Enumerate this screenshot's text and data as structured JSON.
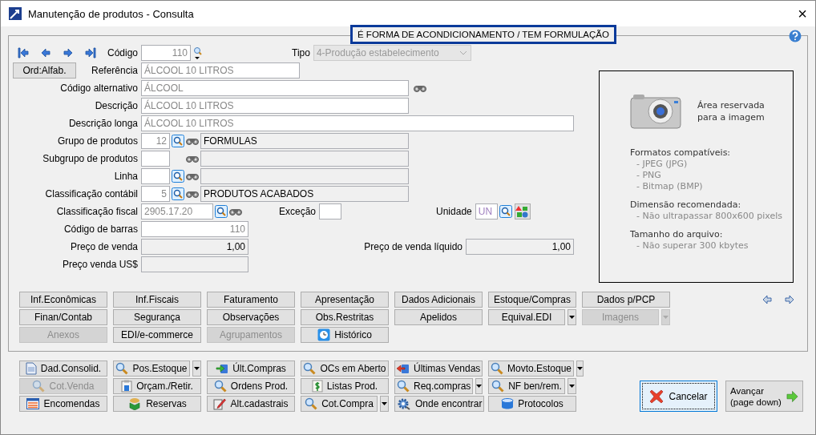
{
  "window": {
    "title": "Manutenção de produtos - Consulta",
    "close": "×"
  },
  "banner": "É FORMA DE ACONDICIONAMENTO / TEM FORMULAÇÃO",
  "codigo": {
    "label": "Código",
    "value": "110"
  },
  "tipo": {
    "label": "Tipo",
    "value": "4-Produção estabelecimento",
    "disabled": true
  },
  "sort_button": "Ord:Alfab.",
  "fields": [
    {
      "kind": "text",
      "label": "Referência",
      "value": "ÁLCOOL 10 LITROS"
    },
    {
      "kind": "text-find",
      "label": "Código alternativo",
      "value": "ÁLCOOL"
    },
    {
      "kind": "text",
      "label": "Descrição",
      "value": "ÁLCOOL 10 LITROS"
    },
    {
      "kind": "text",
      "label": "Descrição longa",
      "value": "ÁLCOOL 10 LITROS"
    },
    {
      "kind": "lookup",
      "label": "Grupo de produtos",
      "value": "12",
      "description": "FORMULAS"
    },
    {
      "kind": "lookup-plain",
      "label": "Subgrupo de produtos"
    },
    {
      "kind": "lookup",
      "label": "Linha"
    },
    {
      "kind": "lookup",
      "label": "Classificação contábil",
      "value": "5",
      "description": "PRODUTOS ACABADOS"
    }
  ],
  "fiscal": {
    "label": "Classificação fiscal",
    "value": "2905.17.20",
    "exception_label": "Exceção",
    "unit_label": "Unidade",
    "unit": "UN"
  },
  "barcode": {
    "label": "Código de barras",
    "value": "110"
  },
  "prices": [
    {
      "label": "Preço de venda",
      "value": "1,00",
      "extra_label": "Preço de venda líquido",
      "extra_value": "1,00"
    },
    {
      "label": "Preço venda US$"
    }
  ],
  "image_area": {
    "caption": "Área reservada\npara a imagem",
    "sections": [
      {
        "heading": "Formatos compatíveis:",
        "items": [
          "- JPEG (JPG)",
          "- PNG",
          "- Bitmap (BMP)"
        ]
      },
      {
        "heading": "Dimensão recomendada:",
        "items": [
          "- Não ultrapassar 800x600 pixels"
        ]
      },
      {
        "heading": "Tamanho do arquivo:",
        "items": [
          "- Não superar 300 kbytes"
        ]
      }
    ]
  },
  "tab_buttons": [
    {
      "label": "Inf.Econômicas",
      "disabled": false,
      "dropdown": false
    },
    {
      "label": "Inf.Fiscais",
      "disabled": false,
      "dropdown": false
    },
    {
      "label": "Faturamento",
      "disabled": false,
      "dropdown": false
    },
    {
      "label": "Apresentação",
      "disabled": false,
      "dropdown": false
    },
    {
      "label": "Dados Adicionais",
      "disabled": false,
      "dropdown": false
    },
    {
      "label": "Estoque/Compras",
      "disabled": false,
      "dropdown": false
    },
    {
      "label": "Dados p/PCP",
      "disabled": false,
      "dropdown": false
    },
    {
      "label": "Finan/Contab",
      "disabled": false,
      "dropdown": false
    },
    {
      "label": "Segurança",
      "disabled": false,
      "dropdown": false
    },
    {
      "label": "Observações",
      "disabled": false,
      "dropdown": false
    },
    {
      "label": "Obs.Restritas",
      "disabled": false,
      "dropdown": false
    },
    {
      "label": "Apelidos",
      "disabled": false,
      "dropdown": false
    },
    {
      "label": "Equival.EDI",
      "disabled": false,
      "dropdown": true
    },
    {
      "label": "Imagens",
      "disabled": true,
      "dropdown": true
    },
    {
      "label": "Anexos",
      "disabled": true,
      "dropdown": false
    },
    {
      "label": "EDI/e-commerce",
      "disabled": false,
      "dropdown": false
    },
    {
      "label": "Agrupamentos",
      "disabled": true,
      "dropdown": false
    },
    {
      "label": "Histórico",
      "disabled": false,
      "dropdown": false,
      "kind": "clock"
    }
  ],
  "actions": [
    {
      "label": "Dad.Consolid.",
      "kind": "document",
      "disabled": false,
      "dropdown": false
    },
    {
      "label": "Pos.Estoque",
      "kind": "magnifier",
      "disabled": false,
      "dropdown": true
    },
    {
      "label": "Últ.Compras",
      "kind": "import",
      "disabled": false,
      "dropdown": false
    },
    {
      "label": "OCs em Aberto",
      "kind": "magnifier",
      "disabled": false,
      "dropdown": false
    },
    {
      "label": "Últimas Vendas",
      "kind": "export",
      "disabled": false,
      "dropdown": false
    },
    {
      "label": "Movto.Estoque",
      "kind": "magnifier",
      "disabled": false,
      "dropdown": true
    },
    {
      "label": "Cot.Venda",
      "kind": "magnifier",
      "disabled": true,
      "dropdown": false
    },
    {
      "label": "Orçam./Retir.",
      "kind": "clipboard",
      "disabled": false,
      "dropdown": false
    },
    {
      "label": "Ordens Prod.",
      "kind": "magnifier",
      "disabled": false,
      "dropdown": false
    },
    {
      "label": "Listas Prod.",
      "kind": "money",
      "disabled": false,
      "dropdown": false
    },
    {
      "label": "Req.compras",
      "kind": "magnifier",
      "disabled": false,
      "dropdown": true
    },
    {
      "label": "NF ben/rem.",
      "kind": "magnifier",
      "disabled": false,
      "dropdown": true
    },
    {
      "label": "Encomendas",
      "kind": "calendar",
      "disabled": false,
      "dropdown": false
    },
    {
      "label": "Reservas",
      "kind": "box",
      "disabled": false,
      "dropdown": false
    },
    {
      "label": "Alt.cadastrais",
      "kind": "edit",
      "disabled": false,
      "dropdown": false
    },
    {
      "label": "Cot.Compra",
      "kind": "magnifier",
      "disabled": false,
      "dropdown": true
    },
    {
      "label": "Onde encontrar",
      "kind": "gear",
      "disabled": false,
      "dropdown": false
    },
    {
      "label": "Protocolos",
      "kind": "database",
      "disabled": false,
      "dropdown": false
    }
  ],
  "cancel_button": {
    "label": "Cancelar",
    "focused": true
  },
  "next_button": {
    "label": "Avançar\n(page down)"
  }
}
